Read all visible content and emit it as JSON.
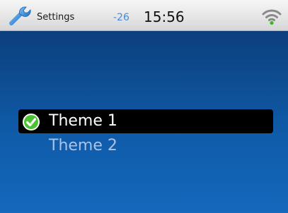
{
  "status_bar": {
    "app_icon": "wrench-icon",
    "title": "Settings",
    "signal_value": "-26",
    "time": "15:56",
    "connection_icon": "wifi-icon",
    "signal_value_color": "#3d8be0"
  },
  "theme_list": {
    "items": [
      {
        "label": "Theme 1",
        "selected": true,
        "icon": "check-icon"
      },
      {
        "label": "Theme 2",
        "selected": false
      }
    ]
  },
  "colors": {
    "background_top": "#0c3f7c",
    "background_bottom": "#1468bd",
    "selection_background": "#000000",
    "check_green": "#4cc230"
  }
}
